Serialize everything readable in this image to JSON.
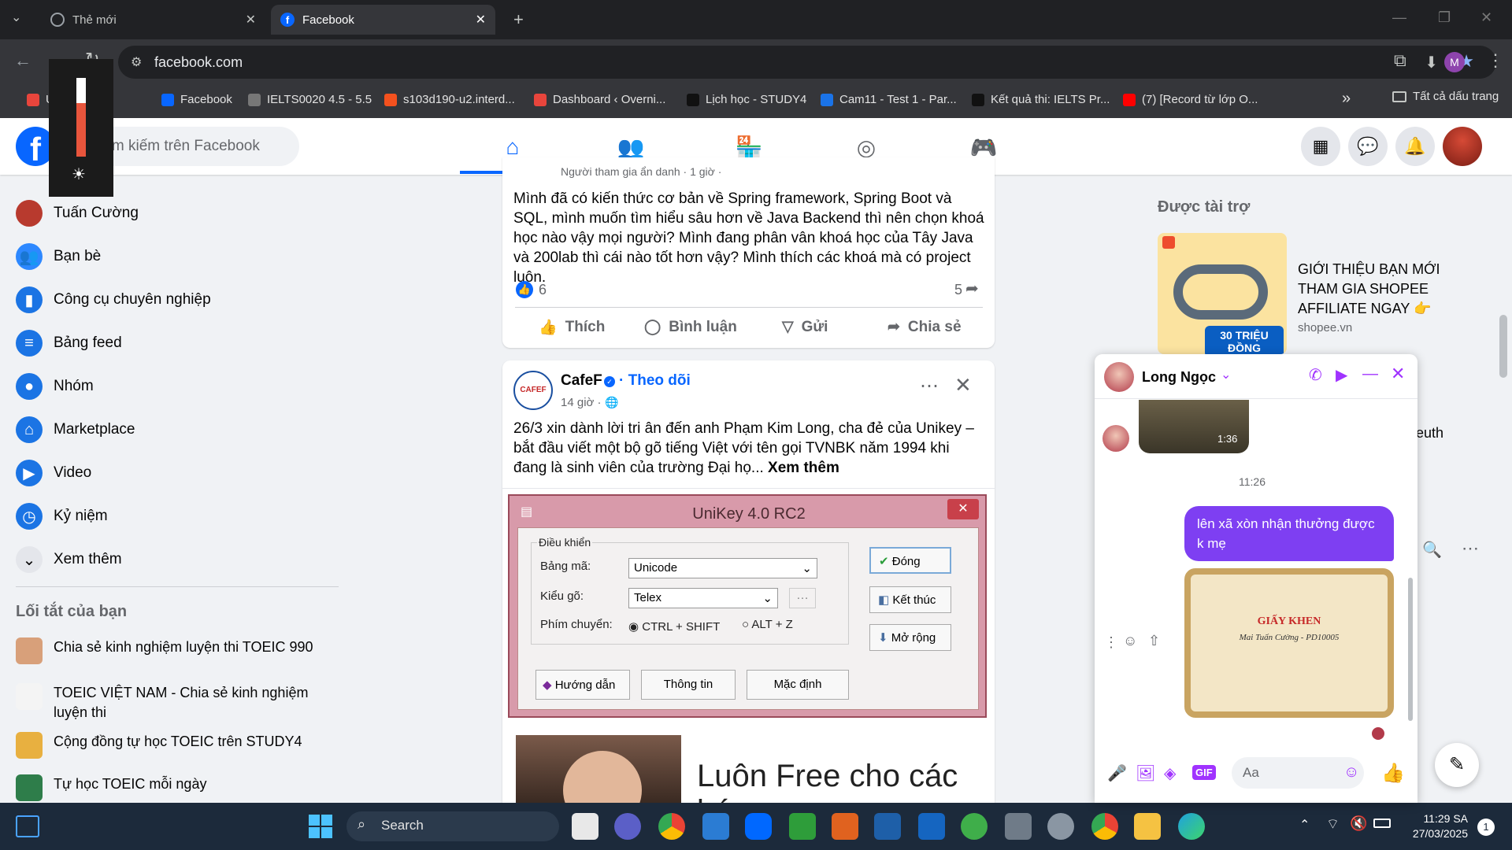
{
  "browser": {
    "tabs": [
      {
        "title": "Thẻ mới"
      },
      {
        "title": "Facebook"
      }
    ],
    "url": "facebook.com",
    "profile_initial": "M",
    "bookmarks": [
      {
        "label": "Ứng",
        "color": "#e8453c"
      },
      {
        "label": "Facebook",
        "color": "#0866ff"
      },
      {
        "label": "IELTS0020 4.5 - 5.5",
        "color": "#777"
      },
      {
        "label": "s103d190-u2.interd...",
        "color": "#f4511e"
      },
      {
        "label": "Dashboard ‹ Overni...",
        "color": "#e8453c"
      },
      {
        "label": "Lịch học - STUDY4",
        "color": "#111"
      },
      {
        "label": "Cam11 - Test 1 - Par...",
        "color": "#1a73e8"
      },
      {
        "label": "Kết quả thi: IELTS Pr...",
        "color": "#111"
      },
      {
        "label": "(7) [Record từ lớp O...",
        "color": "#ff0000"
      }
    ],
    "all_bookmarks": "Tất cả dấu trang"
  },
  "facebook": {
    "search_placeholder": "Tìm kiếm trên Facebook",
    "sidebar": [
      {
        "label": "Tuấn Cường",
        "icon": "avatar",
        "color": "#b83a2e"
      },
      {
        "label": "Bạn bè",
        "icon": "friends-icon",
        "color": "#2d88ff"
      },
      {
        "label": "Công cụ chuyên nghiệp",
        "icon": "chart-icon",
        "color": "#1b74e4"
      },
      {
        "label": "Bảng feed",
        "icon": "feed-icon",
        "color": "#1b74e4"
      },
      {
        "label": "Nhóm",
        "icon": "groups-icon",
        "color": "#1b74e4"
      },
      {
        "label": "Marketplace",
        "icon": "shop-icon",
        "color": "#1b74e4"
      },
      {
        "label": "Video",
        "icon": "video-icon",
        "color": "#1b74e4"
      },
      {
        "label": "Kỷ niệm",
        "icon": "clock-icon",
        "color": "#1b74e4"
      },
      {
        "label": "Xem thêm",
        "icon": "chevron-down-icon",
        "color": "#e4e6eb"
      }
    ],
    "shortcuts_title": "Lối tắt của bạn",
    "shortcuts": [
      {
        "label": "Chia sẻ kinh nghiệm luyện thi TOEIC 990"
      },
      {
        "label": "TOEIC VIỆT NAM - Chia sẻ kinh nghiệm luyện thi"
      },
      {
        "label": "Cộng đồng tự học TOEIC trên STUDY4"
      },
      {
        "label": "Tự học TOEIC mỗi ngày"
      }
    ],
    "post1": {
      "meta": "Người tham gia ẩn danh · 1 giờ ·",
      "text": "Mình đã có kiến thức cơ bản về Spring framework, Spring Boot và SQL, mình muốn tìm hiểu sâu hơn về Java Backend thì nên chọn khoá học nào vậy mọi người? Mình đang phân vân khoá học của Tây Java và 200lab thì cái nào tốt hơn vậy? Mình thích các khoá mà có project luôn.",
      "likes": "6",
      "shares": "5",
      "actions": [
        "Thích",
        "Bình luận",
        "Gửi",
        "Chia sẻ"
      ]
    },
    "post2": {
      "page": "CafeF",
      "follow": "Theo dõi",
      "time": "14 giờ ·",
      "text": "26/3 xin dành lời tri ân đến anh Phạm Kim Long, cha đẻ của Unikey – bắt đầu viết một bộ gõ tiếng Việt với tên gọi TVNBK năm 1994 khi đang là sinh viên của trường Đại họ...",
      "see_more": "Xem thêm",
      "unikey": {
        "title": "UniKey 4.0 RC2",
        "group": "Điều khiển",
        "charset_label": "Bảng mã:",
        "charset": "Unicode",
        "input_label": "Kiểu gõ:",
        "input": "Telex",
        "switch_label": "Phím chuyển:",
        "opt1": "CTRL + SHIFT",
        "opt2": "ALT + Z",
        "btn_close": "Đóng",
        "btn_end": "Kết thúc",
        "btn_expand": "Mở rộng",
        "btn_help": "Hướng dẫn",
        "btn_info": "Thông tin",
        "btn_default": "Mặc định"
      },
      "banner": "Luôn Free cho các bác"
    },
    "sponsored_title": "Được tài trợ",
    "ad": {
      "title": "GIỚI THIỆU BẠN MỚI THAM GIA SHOPEE AFFILIATE NGAY 👉",
      "domain": "shopee.vn",
      "badge": "30 TRIỆU ĐỒNG"
    },
    "contacts_partial": "euth"
  },
  "chat": {
    "name": "Long Ngọc",
    "video_duration": "1:36",
    "time": "11:26",
    "message": "lên xã xòn nhận thưởng được k mẹ",
    "certificate_title": "GIẤY KHEN",
    "certificate_name": "Mai Tuấn Cường - PD10005",
    "input_placeholder": "Aa"
  },
  "taskbar": {
    "search": "Search",
    "time": "11:29 SA",
    "date": "27/03/2025",
    "notifications": "1"
  },
  "colors": {
    "fb_blue": "#0866ff",
    "chat_purple": "#7e3ff2",
    "messenger_accent": "#a033ff"
  }
}
